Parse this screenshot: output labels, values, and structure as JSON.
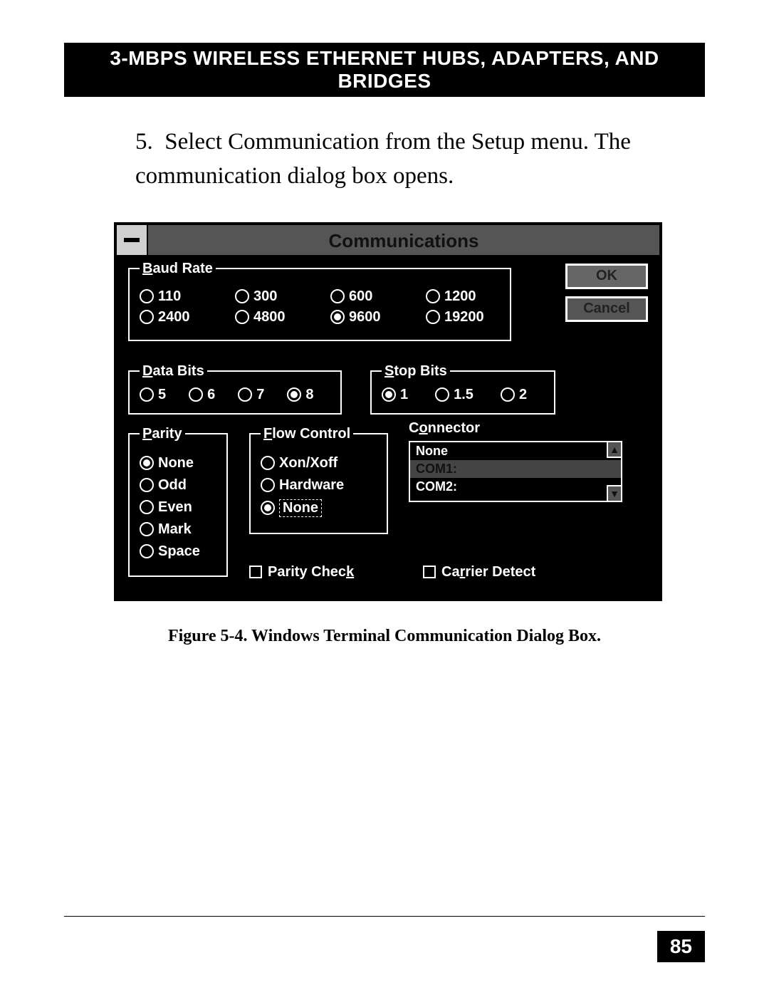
{
  "header": "3-MBPS WIRELESS ETHERNET HUBS, ADAPTERS, AND BRIDGES",
  "instruction_num": "5.",
  "instruction": "Select Communication from the Setup menu. The communication dialog box opens.",
  "dialog": {
    "title": "Communications",
    "ok": "OK",
    "cancel": "Cancel",
    "baud": {
      "legend_u": "B",
      "legend_rest": "aud Rate",
      "options": [
        "110",
        "300",
        "600",
        "1200",
        "2400",
        "4800",
        "9600",
        "19200"
      ],
      "selected": "9600"
    },
    "databits": {
      "legend_u": "D",
      "legend_rest": "ata Bits",
      "options": [
        "5",
        "6",
        "7",
        "8"
      ],
      "selected": "8"
    },
    "stopbits": {
      "legend_u": "S",
      "legend_rest": "top Bits",
      "options": [
        "1",
        "1.5",
        "2"
      ],
      "selected": "1"
    },
    "parity": {
      "legend_u": "P",
      "legend_rest": "arity",
      "options": [
        "None",
        "Odd",
        "Even",
        "Mark",
        "Space"
      ],
      "selected": "None"
    },
    "flow": {
      "legend_u": "F",
      "legend_rest": "low Control",
      "options": [
        "Xon/Xoff",
        "Hardware",
        "None"
      ],
      "selected": "None"
    },
    "connector": {
      "label_pre": "C",
      "label_u": "o",
      "label_post": "nnector",
      "items": [
        "None",
        "COM1:",
        "COM2:"
      ],
      "selected": "COM1:"
    },
    "parity_check_pre": "Parity Chec",
    "parity_check_u": "k",
    "carrier_pre": "Ca",
    "carrier_u": "r",
    "carrier_post": "rier Detect"
  },
  "caption": "Figure 5-4.  Windows Terminal Communication Dialog Box.",
  "page_number": "85"
}
